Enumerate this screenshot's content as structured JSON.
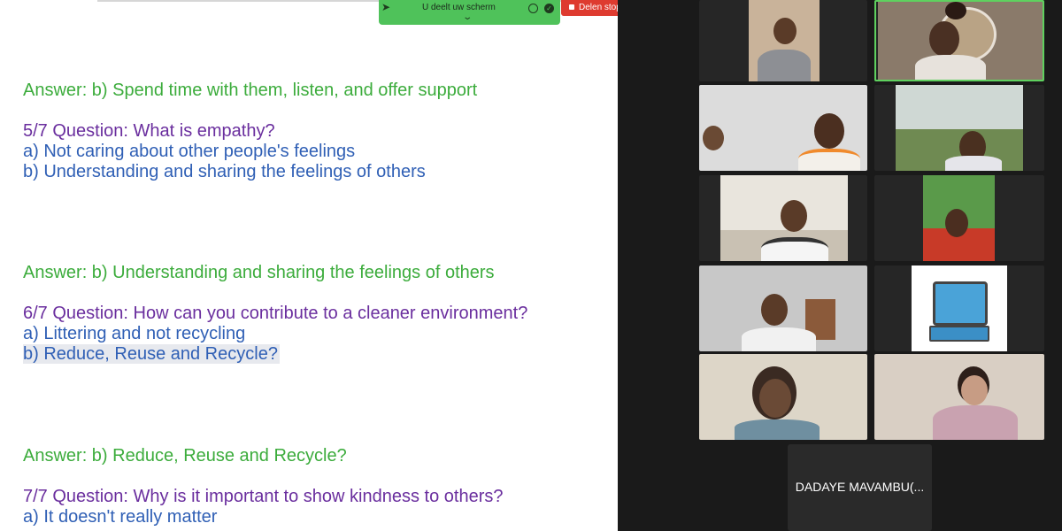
{
  "share_bar": {
    "label": "U deelt uw scherm",
    "stop_label": "Delen stoppen"
  },
  "document": {
    "lines": [
      {
        "text": "Answer: b) Spend time with them, listen, and offer support",
        "color": "#3cac3c"
      },
      {
        "text": "5/7 Question: What is empathy?",
        "color": "#6a2e9e"
      },
      {
        "text": "a) Not caring about other people's feelings",
        "color": "#2f5fb5"
      },
      {
        "text": "b) Understanding and sharing the feelings of others",
        "color": "#2f5fb5"
      },
      {
        "text": "Answer: b) Understanding and sharing the feelings of others",
        "color": "#3cac3c"
      },
      {
        "text": "6/7 Question: How can you contribute to a cleaner environment?",
        "color": "#6a2e9e"
      },
      {
        "text": "a) Littering and not recycling",
        "color": "#2f5fb5"
      },
      {
        "text": "b) Reduce, Reuse and Recycle?",
        "color": "#2f5fb5"
      },
      {
        "text": "Answer: b) Reduce, Reuse and Recycle?",
        "color": "#3cac3c"
      },
      {
        "text": "7/7 Question: Why is it important to show kindness to others?",
        "color": "#6a2e9e"
      },
      {
        "text": "a) It doesn't really matter",
        "color": "#2f5fb5"
      }
    ]
  },
  "participants": {
    "name_tile_label": "DADAYE MAVAMBU(..."
  },
  "colors": {
    "share_bar": "#4fc25a",
    "stop_button": "#de3b2f",
    "active_speaker_border": "#5fd15f",
    "answer_text": "#3cac3c",
    "question_text": "#6a2e9e",
    "option_text": "#2f5fb5"
  }
}
